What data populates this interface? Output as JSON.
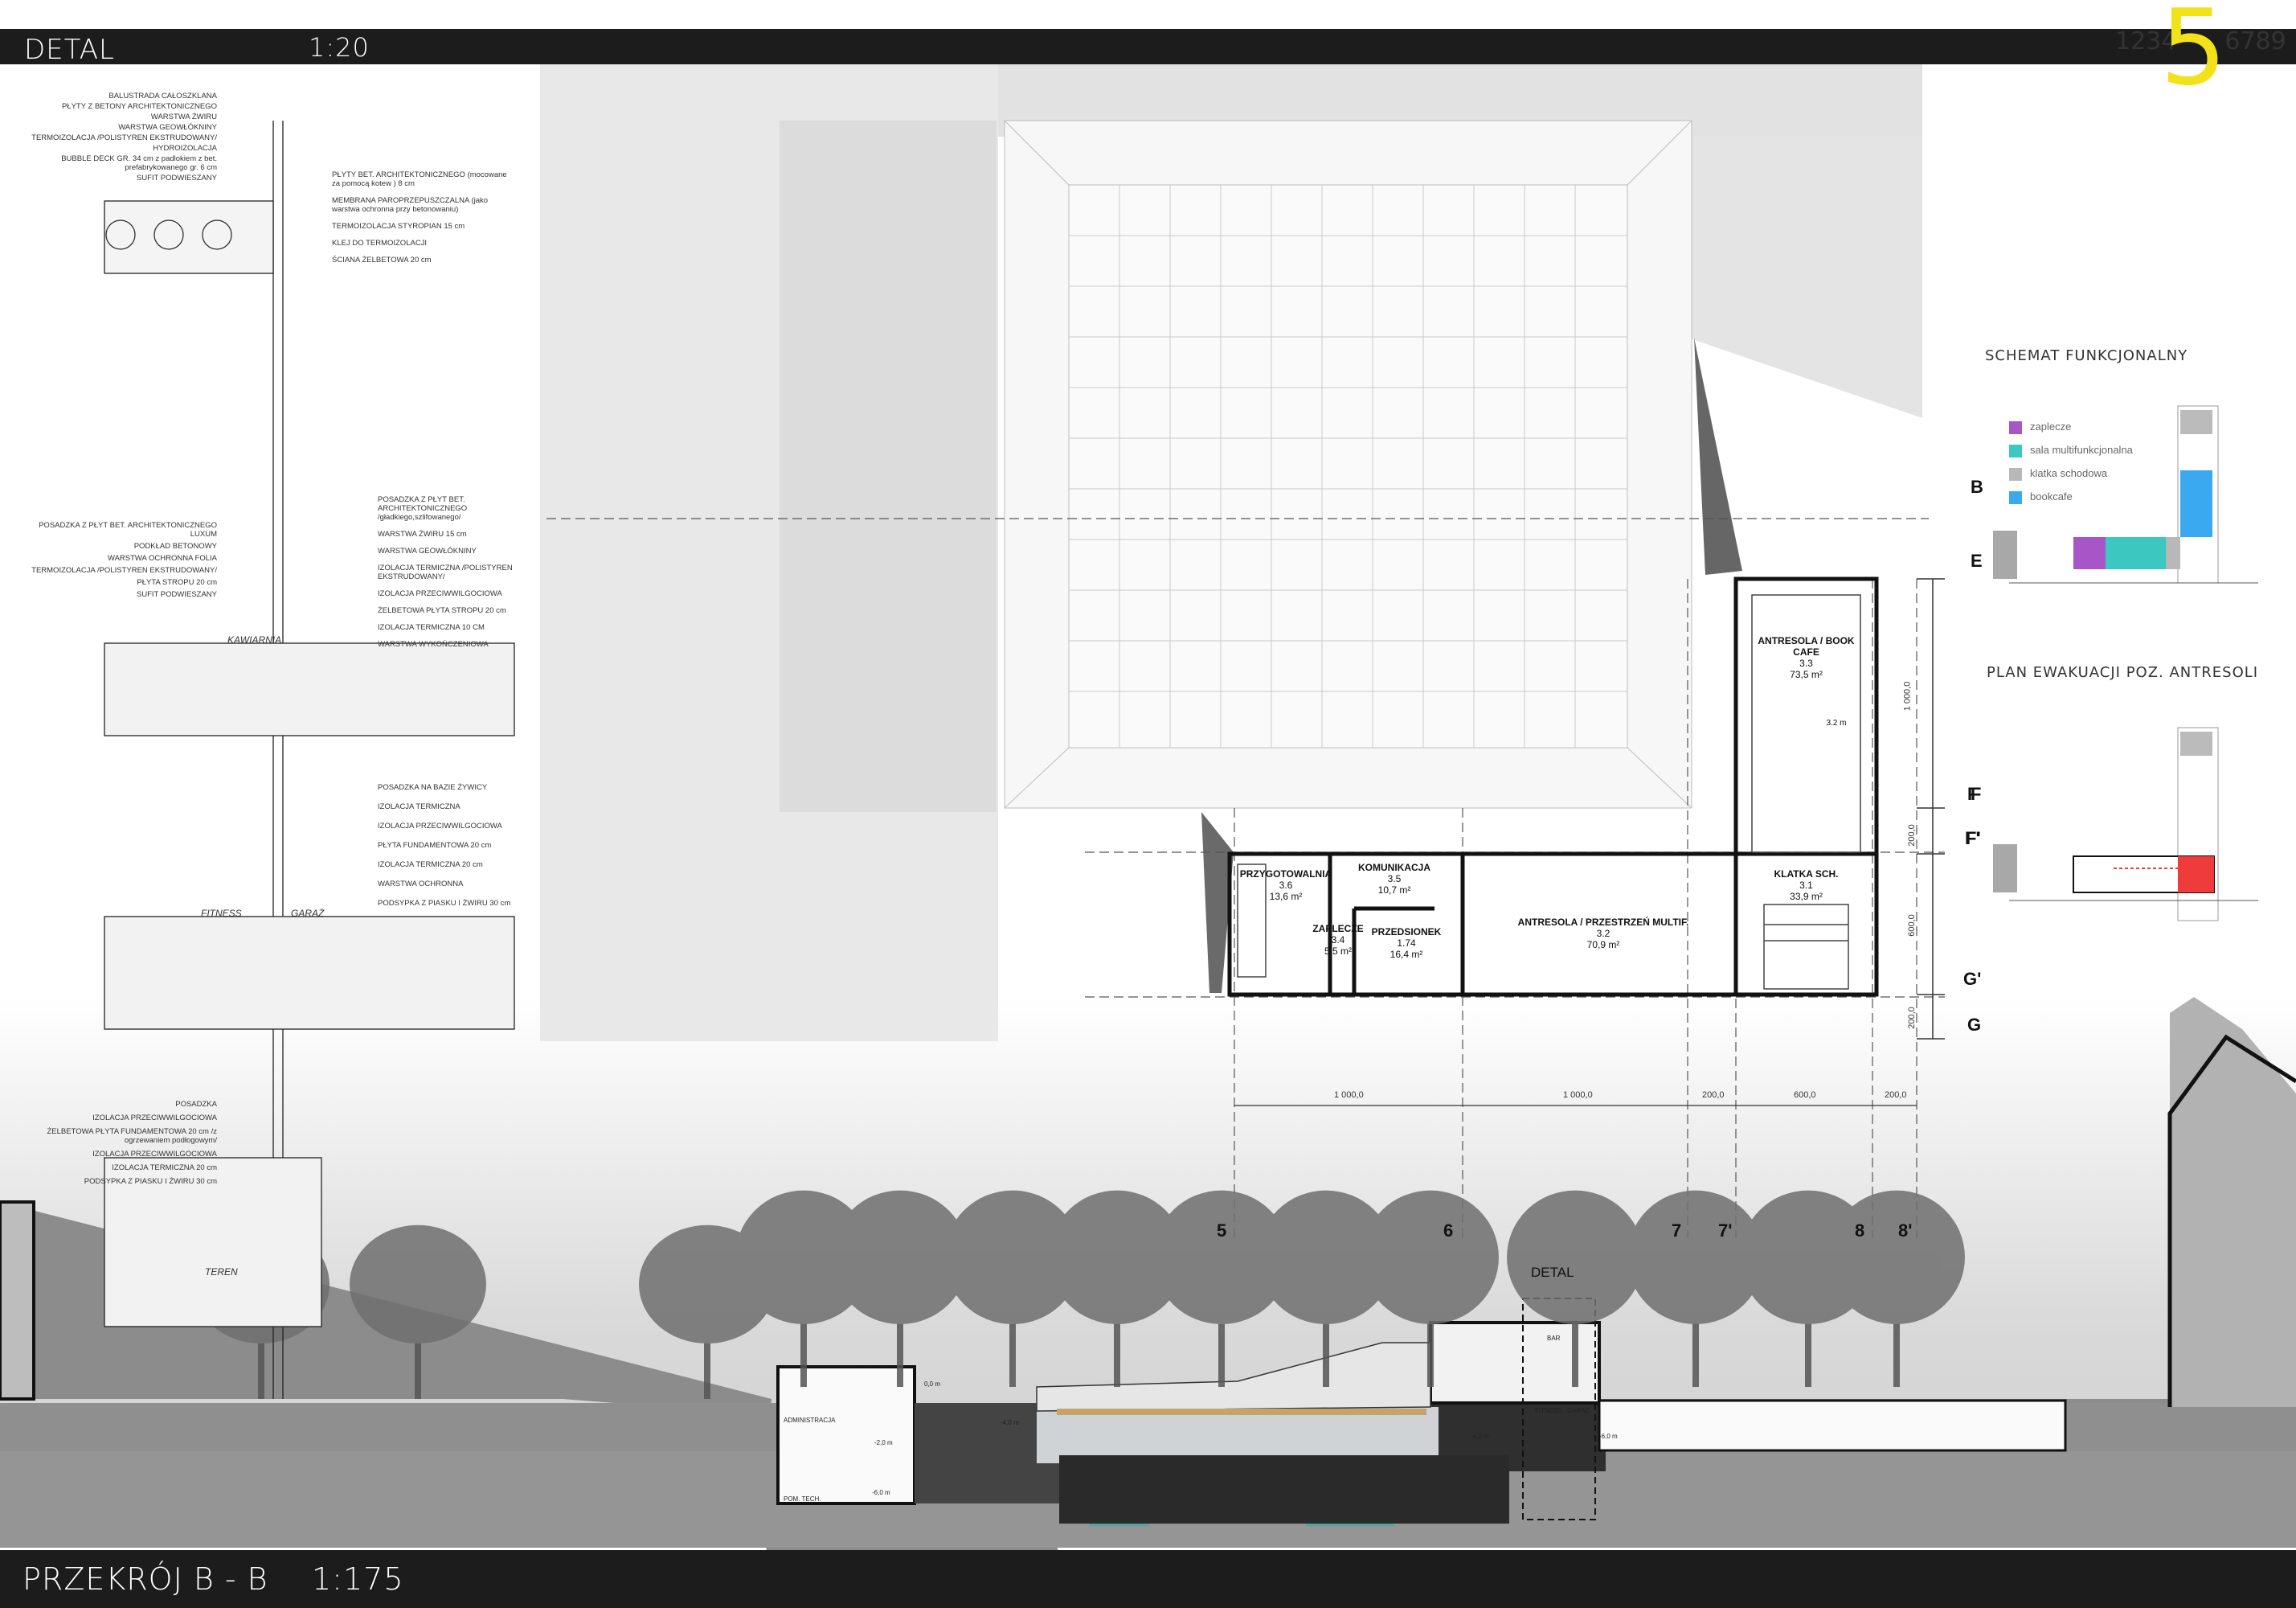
{
  "header": {
    "title": "DETAL",
    "scale": "1:20",
    "page_numbers_left": "1234",
    "page_current": "5",
    "page_numbers_right": "6789"
  },
  "footer": {
    "title": "PRZEKRÓJ B - B",
    "scale": "1:175"
  },
  "detail": {
    "group1_left": [
      "BALUSTRADA CAŁOSZKLANA",
      "PŁYTY Z BETONY ARCHITEKTONICZNEGO",
      "WARSTWA ŻWIRU",
      "WARSTWA GEOWŁÓKNINY",
      "TERMOIZOLACJA /POLISTYREN EKSTRUDOWANY/",
      "HYDROIZOLACJA",
      "BUBBLE DECK GR. 34 cm z padlokiem z bet. prefabrykowanego gr. 6 cm",
      "SUFIT PODWIESZANY"
    ],
    "group1_right": [
      "PŁYTY BET. ARCHITEKTONICZNEGO (mocowane za pomocą kotew ) 8 cm",
      "MEMBRANA PAROPRZEPUSZCZALNA (jako warstwa ochronna przy betonowaniu)",
      "TERMOIZOLACJA STYROPIAN 15 cm",
      "KLEJ DO TERMOIZOLACJI",
      "ŚCIANA ŻELBETOWA 20 cm"
    ],
    "group2_left": [
      "POSADZKA Z PŁYT BET. ARCHITEKTONICZNEGO LUXUM",
      "PODKŁAD BETONOWY",
      "WARSTWA OCHRONNA FOLIA",
      "TERMOIZOLACJA /POLISTYREN EKSTRUDOWANY/",
      "PŁYTA STROPU 20 cm",
      "SUFIT PODWIESZANY"
    ],
    "group2_right": [
      "POSADZKA Z PŁYT BET. ARCHITEKTONICZNEGO /gładkiego,szlifowanego/",
      "WARSTWA ŻWIRU 15 cm",
      "WARSTWA GEOWŁÓKNINY",
      "IZOLACJA TERMICZNA /POLISTYREN EKSTRUDOWANY/",
      "IZOLACJA PRZECIWWILGOCIOWA",
      "ŻELBETOWA PŁYTA STROPU 20 cm",
      "IZOLACJA TERMICZNA 10 CM",
      "WARSTWA WYKOŃCZENIOWA"
    ],
    "group3_right": [
      "POSADZKA NA BAZIE ŻYWICY",
      "IZOLACJA TERMICZNA",
      "IZOLACJA PRZECIWWILGOCIOWA",
      "PŁYTA FUNDAMENTOWA 20 cm",
      "IZOLACJA TERMICZNA 20 cm",
      "WARSTWA OCHRONNA",
      "PODSYPKA Z PIASKU I ŻWIRU 30 cm"
    ],
    "group4_left": [
      "POSADZKA",
      "IZOLACJA PRZECIWWILGOCIOWA",
      "ŻELBETOWA PŁYTA FUNDAMENTOWA 20 cm /z ogrzewaniem podłogowym/",
      "IZOLACJA PRZECIWWILGOCIOWA",
      "IZOLACJA TERMICZNA 20 cm",
      "PODSYPKA Z PIASKU I ŻWIRU 30 cm"
    ],
    "label_kawiarnia": "KAWIARNIA",
    "label_fitness": "FITNESS",
    "label_garaz": "GARAŻ",
    "label_teren": "TEREN"
  },
  "plan": {
    "rooms": [
      {
        "name": "PRZYGOTOWALNIA",
        "num": "3.6",
        "area": "13,6 m²"
      },
      {
        "name": "KOMUNIKACJA",
        "num": "3.5",
        "area": "10,7 m²"
      },
      {
        "name": "ZAPLECZE",
        "num": "3.4",
        "area": "5,5 m²"
      },
      {
        "name": "PRZEDSIONEK",
        "num": "1.74",
        "area": "16,4 m²"
      },
      {
        "name": "ANTRESOLA / PRZESTRZEŃ MULTIF.",
        "num": "3.2",
        "area": "70,9 m²"
      },
      {
        "name": "KLATKA SCH.",
        "num": "3.1",
        "area": "33,9 m²"
      },
      {
        "name": "ANTRESOLA / BOOK CAFE",
        "num": "3.3",
        "area": "73,5 m²"
      }
    ],
    "level_mark": "3.2 m",
    "axes_right": [
      "F",
      "F'",
      "G'",
      "G"
    ],
    "axes_dims": [
      "1 000,0",
      "200,0",
      "600,0",
      "200,0"
    ],
    "bottom_dims": [
      "1 000,0",
      "1 000,0",
      "200,0",
      "600,0",
      "200,0"
    ],
    "section_axes": [
      "5",
      "6",
      "7",
      "7'",
      "8",
      "8'"
    ]
  },
  "schemat": {
    "title": "SCHEMAT FUNKCJONALNY",
    "legend": [
      {
        "label": "zaplecze",
        "color": "#a855c8"
      },
      {
        "label": "sala multifunkcjonalna",
        "color": "#3cc7c0"
      },
      {
        "label": "klatka schodowa",
        "color": "#b8b8b8"
      },
      {
        "label": "bookcafe",
        "color": "#3aa9f0"
      }
    ],
    "axis_b": "B",
    "axis_e": "E"
  },
  "ewakuacja": {
    "title": "PLAN EWAKUACJI POZ. ANTRESOLI",
    "axis_f": "F",
    "axis_f2": "F'"
  },
  "section": {
    "detal_label": "DETAL",
    "labels": [
      "ADMINISTRACJA",
      "POM. TECH.",
      "FITNESS",
      "GARAŻ",
      "BAR"
    ],
    "levels": [
      "0,0 m",
      "-2,0 m",
      "-4,0 m",
      "-6,0 m",
      "-4,0 m",
      "-6,0 m"
    ]
  }
}
